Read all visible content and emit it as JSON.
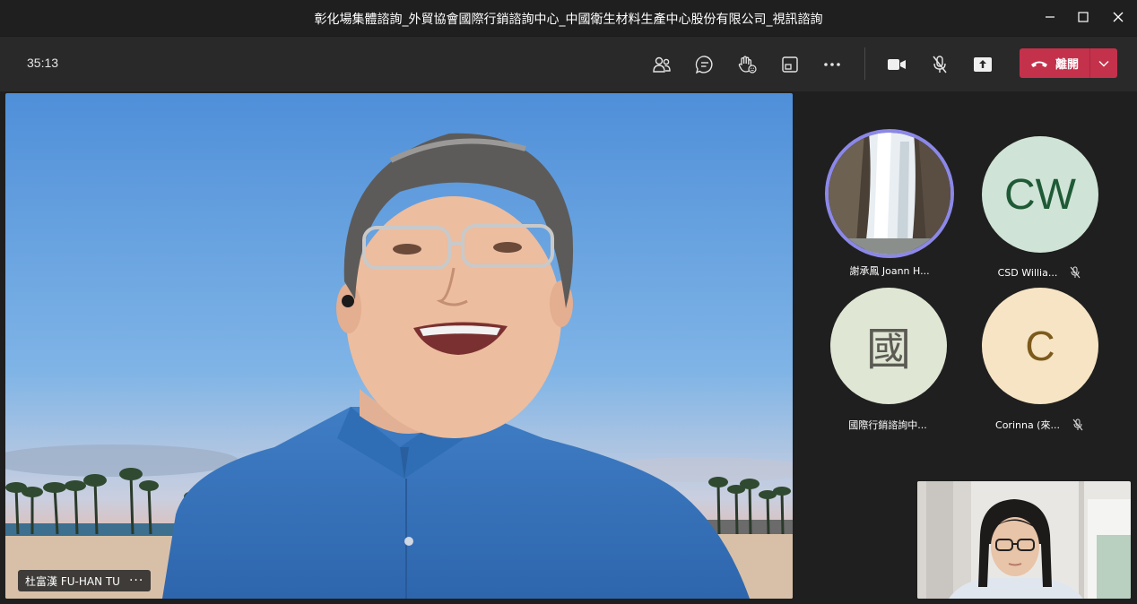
{
  "window": {
    "title": "彰化場集體諮詢_外貿協會國際行銷諮詢中心_中國衛生材料生產中心股份有限公司_視訊諮詢"
  },
  "toolbar": {
    "timer": "35:13",
    "buttons": [
      {
        "name": "people",
        "icon": "people-icon"
      },
      {
        "name": "chat",
        "icon": "chat-icon"
      },
      {
        "name": "reactions",
        "icon": "raise-hand-icon"
      },
      {
        "name": "rooms",
        "icon": "breakout-rooms-icon"
      },
      {
        "name": "more",
        "icon": "more-options-icon"
      },
      {
        "name": "camera",
        "icon": "camera-icon"
      },
      {
        "name": "mic",
        "icon": "mic-off-icon"
      },
      {
        "name": "share",
        "icon": "share-screen-icon"
      }
    ],
    "leave_label": "離開",
    "leave_color": "#c4314b"
  },
  "main_video": {
    "speaker_name": "杜富漢 FU-HAN TU",
    "more_label": "···"
  },
  "participants": [
    {
      "name": "謝承鳳 Joann H...",
      "initials": "",
      "bg": "#2a2a2a",
      "fg": "#ffffff",
      "muted": false,
      "speaking": true
    },
    {
      "name": "CSD Willia...",
      "initials": "CW",
      "bg": "#cfe3d6",
      "fg": "#1f5a36",
      "muted": true,
      "speaking": false
    },
    {
      "name": "國際行銷諮詢中...",
      "initials": "國",
      "bg": "#dfe6d4",
      "fg": "#5b5b54",
      "muted": false,
      "speaking": false
    },
    {
      "name": "Corinna (來...",
      "initials": "C",
      "bg": "#f6e4c4",
      "fg": "#7c5a1c",
      "muted": true,
      "speaking": false
    }
  ],
  "colors": {
    "speaking_ring": "#8c88e8",
    "toolbar_bg": "#292929",
    "app_bg": "#1f1f1f"
  }
}
